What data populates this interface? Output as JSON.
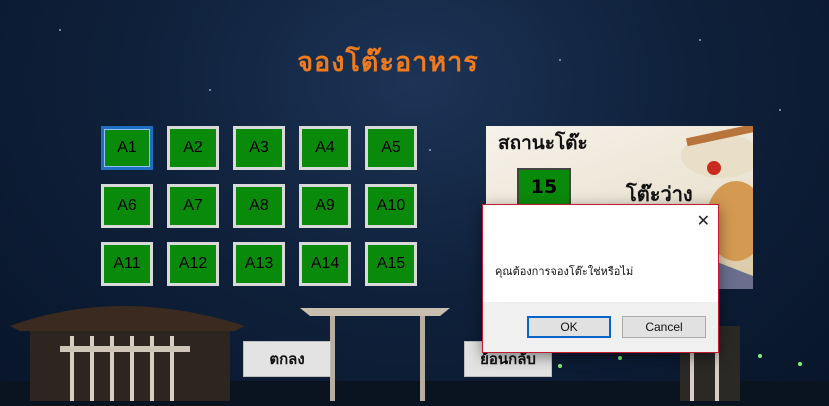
{
  "page": {
    "title": "จองโต๊ะอาหาร"
  },
  "tables": [
    {
      "label": "A1"
    },
    {
      "label": "A2"
    },
    {
      "label": "A3"
    },
    {
      "label": "A4"
    },
    {
      "label": "A5"
    },
    {
      "label": "A6"
    },
    {
      "label": "A7"
    },
    {
      "label": "A8"
    },
    {
      "label": "A9"
    },
    {
      "label": "A10"
    },
    {
      "label": "A11"
    },
    {
      "label": "A12"
    },
    {
      "label": "A13"
    },
    {
      "label": "A14"
    },
    {
      "label": "A15"
    }
  ],
  "status": {
    "title": "สถานะโต๊ะ",
    "count": "15",
    "label": "โต๊ะว่าง"
  },
  "buttons": {
    "confirm": "ตกลง",
    "back": "ย้อนกลับ"
  },
  "dialog": {
    "message": "คุณต้องการจองโต๊ะใช่หรือไม่",
    "ok": "OK",
    "cancel": "Cancel",
    "close": "✕"
  },
  "colors": {
    "title": "#f07b1c",
    "table_free": "#0a8a0a",
    "selected_border": "#1e6fc4"
  }
}
